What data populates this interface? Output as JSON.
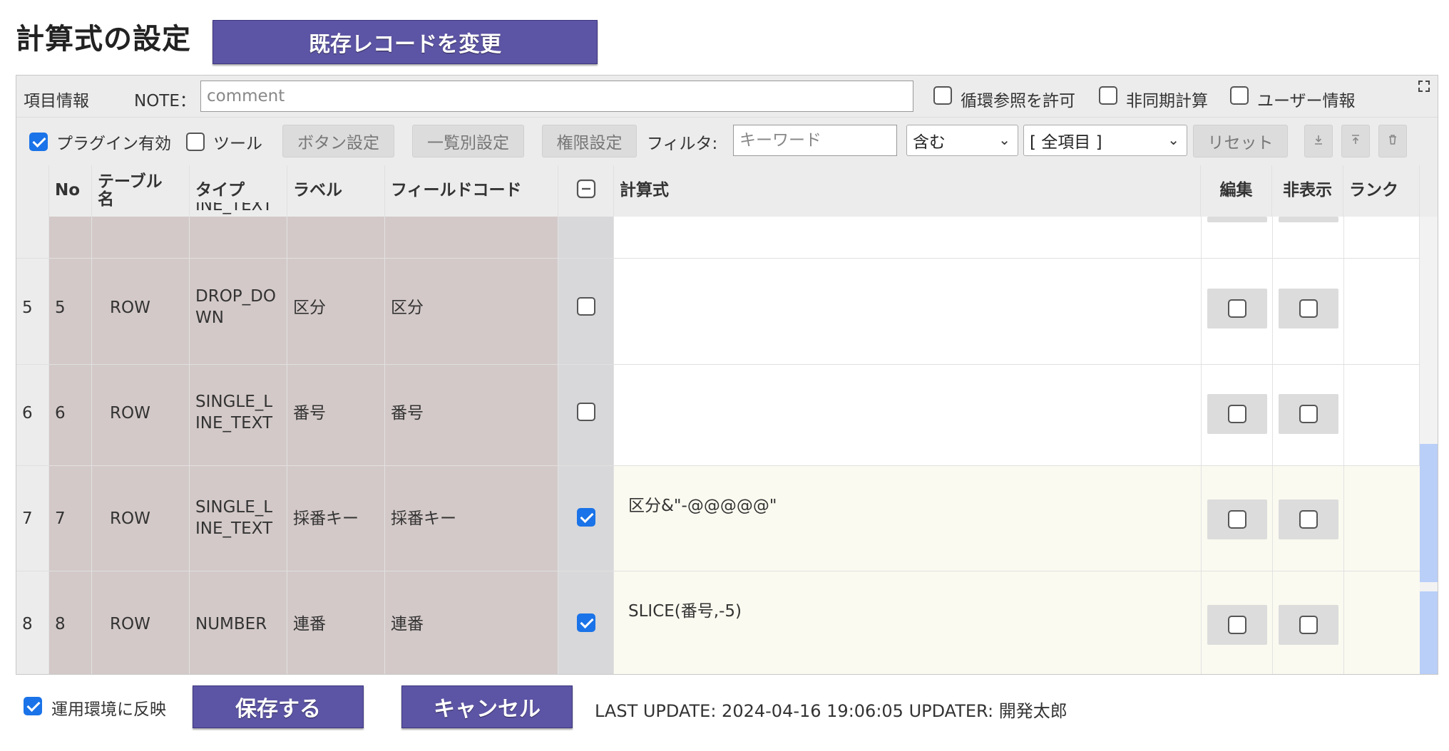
{
  "title": "計算式の設定",
  "change_record_label": "既存レコードを変更",
  "toolbar1": {
    "section_label": "項目情報",
    "note_label": "NOTE：",
    "note_placeholder": "comment",
    "allow_circular_label": "循環参照を許可",
    "async_calc_label": "非同期計算",
    "user_info_label": "ユーザー情報"
  },
  "toolbar2": {
    "plugin_enabled_label": "プラグイン有効",
    "tool_label": "ツール",
    "button_settings_label": "ボタン設定",
    "list_settings_label": "一覧別設定",
    "permission_settings_label": "権限設定",
    "filter_label": "フィルタ:",
    "keyword_placeholder": "キーワード",
    "match_select_value": "含む",
    "items_select_value": "[ 全項目 ]",
    "reset_label": "リセット"
  },
  "table": {
    "headers": {
      "no": "No",
      "table_name": "テーブル名",
      "type": "タイプ",
      "label": "ラベル",
      "field_code": "フィールドコード",
      "formula": "計算式",
      "edit": "編集",
      "hide": "非表示",
      "rank": "ランク"
    },
    "partial_row_text": "INE_TEXT",
    "rows": [
      {
        "index": "5",
        "no": "5",
        "table": "ROW",
        "type1": "DROP_DO",
        "type2": "WN",
        "label": "区分",
        "code": "区分",
        "checked": false,
        "formula": ""
      },
      {
        "index": "6",
        "no": "6",
        "table": "ROW",
        "type1": "SINGLE_L",
        "type2": "INE_TEXT",
        "label": "番号",
        "code": "番号",
        "checked": false,
        "formula": ""
      },
      {
        "index": "7",
        "no": "7",
        "table": "ROW",
        "type1": "SINGLE_L",
        "type2": "INE_TEXT",
        "label": "採番キー",
        "code": "採番キー",
        "checked": true,
        "formula": "区分&\"-@@@@@\""
      },
      {
        "index": "8",
        "no": "8",
        "table": "ROW",
        "type1": "NUMBER",
        "type2": "",
        "label": "連番",
        "code": "連番",
        "checked": true,
        "formula": "SLICE(番号,-5)"
      }
    ]
  },
  "footer": {
    "reflect_label": "運用環境に反映",
    "save_label": "保存する",
    "cancel_label": "キャンセル",
    "last_update": "LAST UPDATE: 2024-04-16 19:06:05 UPDATER: 開発太郎"
  },
  "colors": {
    "brand_purple": "#5c54a4",
    "left_cols_bg": "#d3c9c8",
    "checkbox_col_bg": "#d8d8da",
    "formula_row_bg": "#fbfaf0",
    "scroll_thumb": "#b9cff8",
    "checkbox_blue": "#1a73e8"
  }
}
